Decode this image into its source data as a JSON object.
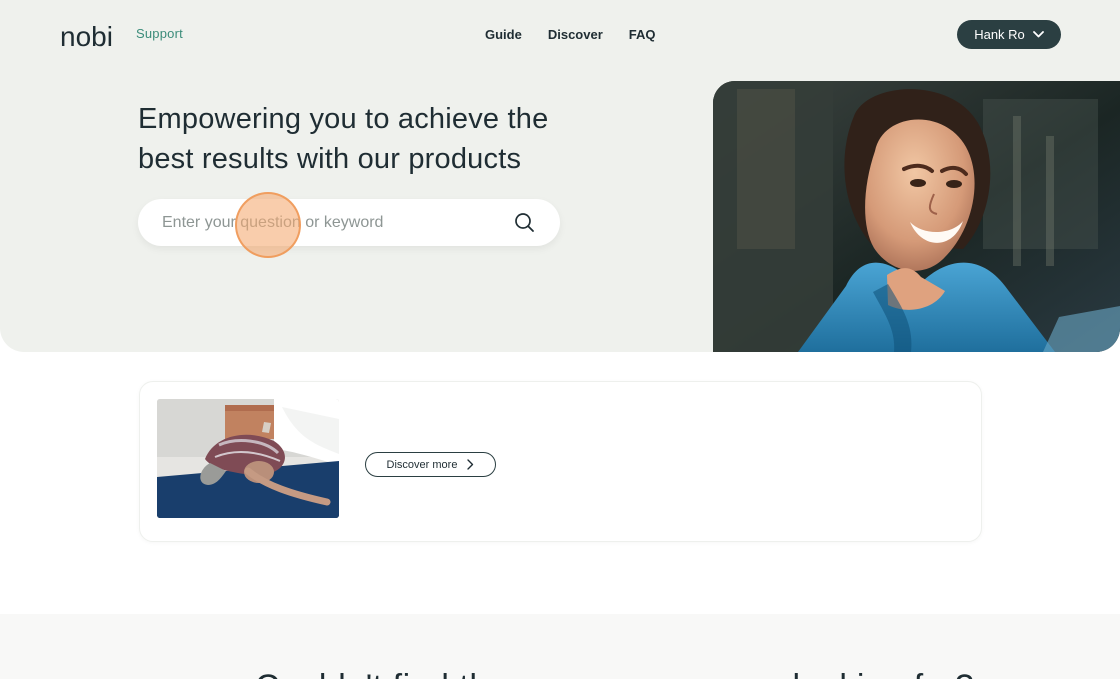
{
  "brand": {
    "logo_text": "nobi",
    "support_label": "Support"
  },
  "nav": {
    "items": [
      {
        "label": "Guide"
      },
      {
        "label": "Discover"
      },
      {
        "label": "FAQ"
      }
    ]
  },
  "user": {
    "name": "Hank Ro"
  },
  "hero": {
    "title": "Empowering you to achieve the best results with our products",
    "search": {
      "value": "",
      "placeholder": "Enter your question or keyword"
    }
  },
  "card": {
    "button_label": "Discover more"
  },
  "bottom": {
    "heading": "Couldn't find the answer you were looking for?"
  },
  "colors": {
    "hero_background": "#eff1ed",
    "brand_green": "#3b8c7a",
    "dark_button": "#2b3f42",
    "click_marker": "#f4a970"
  },
  "icons": {
    "search": "search-icon",
    "chevron_user": "chevron-down-icon",
    "chevron_card": "chevron-right-icon"
  }
}
